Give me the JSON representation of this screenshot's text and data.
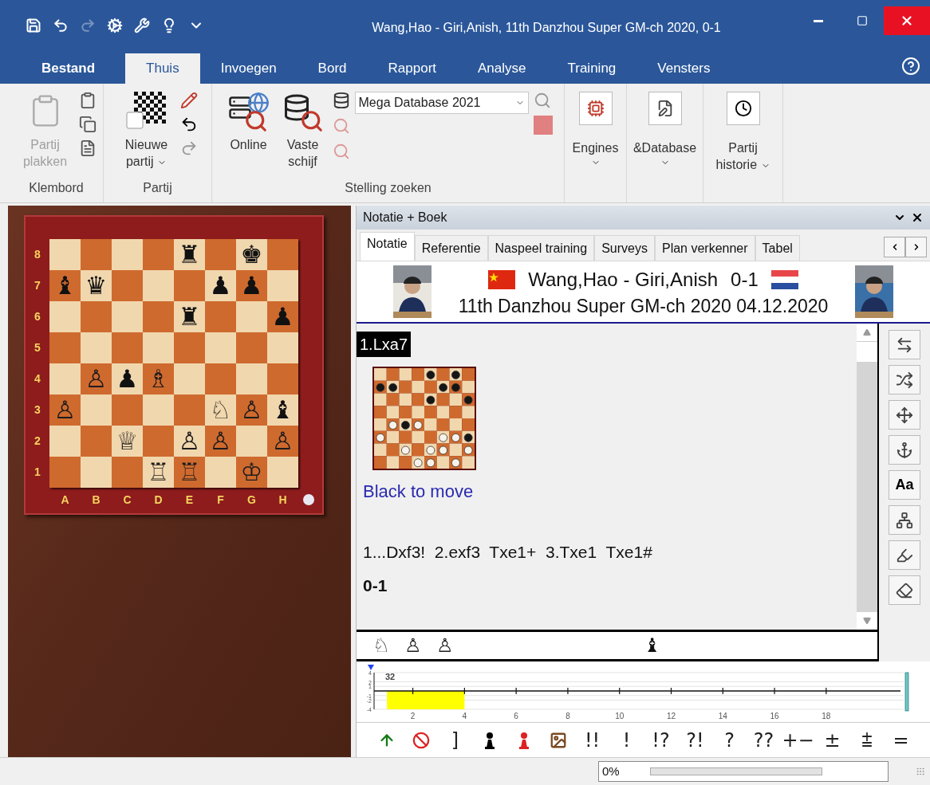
{
  "window": {
    "title": "Wang,Hao - Giri,Anish, 11th Danzhou Super GM-ch 2020, 0-1"
  },
  "quick_access": [
    {
      "kind": "save",
      "disabled": false
    },
    {
      "kind": "undo",
      "disabled": false
    },
    {
      "kind": "redo",
      "disabled": true
    },
    {
      "kind": "engine",
      "disabled": false
    },
    {
      "kind": "wrench",
      "disabled": false
    },
    {
      "kind": "bulb",
      "disabled": false
    },
    {
      "kind": "customize",
      "disabled": false
    }
  ],
  "ribbon_tabs": [
    {
      "label": "Bestand",
      "kind": "file",
      "selected": false
    },
    {
      "label": "Thuis",
      "kind": "tab",
      "selected": true
    },
    {
      "label": "Invoegen",
      "kind": "tab",
      "selected": false
    },
    {
      "label": "Bord",
      "kind": "tab",
      "selected": false
    },
    {
      "label": "Rapport",
      "kind": "tab",
      "selected": false
    },
    {
      "label": "Analyse",
      "kind": "tab",
      "selected": false
    },
    {
      "label": "Training",
      "kind": "tab",
      "selected": false
    },
    {
      "label": "Vensters",
      "kind": "tab",
      "selected": false
    }
  ],
  "clipboard_group": {
    "label": "Klembord",
    "paste": {
      "label": "Partij plakken",
      "disabled": true
    }
  },
  "game_group": {
    "label": "Partij",
    "new_game": {
      "label": "Nieuwe partij"
    }
  },
  "search_group": {
    "label": "Stelling zoeken",
    "online": {
      "label": "Online"
    },
    "hard_disk": {
      "label": "Vaste schijf"
    },
    "database_select": {
      "value": "Mega Database 2021"
    }
  },
  "tools_group": [
    {
      "label": "Engines",
      "kind": "engines"
    },
    {
      "label": "&Database",
      "kind": "database"
    },
    {
      "label": "Partij historie",
      "kind": "history"
    }
  ],
  "board": {
    "rows": [
      {
        "rank": "8",
        "squares": [
          {
            "kind": "empty"
          },
          {
            "kind": "empty"
          },
          {
            "kind": "empty"
          },
          {
            "kind": "empty"
          },
          {
            "kind": "black",
            "glyph": "♜"
          },
          {
            "kind": "empty"
          },
          {
            "kind": "black",
            "glyph": "♚"
          },
          {
            "kind": "empty"
          }
        ]
      },
      {
        "rank": "7",
        "squares": [
          {
            "kind": "black",
            "glyph": "♝"
          },
          {
            "kind": "black",
            "glyph": "♛"
          },
          {
            "kind": "empty"
          },
          {
            "kind": "empty"
          },
          {
            "kind": "empty"
          },
          {
            "kind": "black",
            "glyph": "♟"
          },
          {
            "kind": "black",
            "glyph": "♟"
          },
          {
            "kind": "empty"
          }
        ]
      },
      {
        "rank": "6",
        "squares": [
          {
            "kind": "empty"
          },
          {
            "kind": "empty"
          },
          {
            "kind": "empty"
          },
          {
            "kind": "empty"
          },
          {
            "kind": "black",
            "glyph": "♜"
          },
          {
            "kind": "empty"
          },
          {
            "kind": "empty"
          },
          {
            "kind": "black",
            "glyph": "♟"
          }
        ]
      },
      {
        "rank": "5",
        "squares": [
          {
            "kind": "empty"
          },
          {
            "kind": "empty"
          },
          {
            "kind": "empty"
          },
          {
            "kind": "empty"
          },
          {
            "kind": "empty"
          },
          {
            "kind": "empty"
          },
          {
            "kind": "empty"
          },
          {
            "kind": "empty"
          }
        ]
      },
      {
        "rank": "4",
        "squares": [
          {
            "kind": "empty"
          },
          {
            "kind": "white",
            "glyph": "♙"
          },
          {
            "kind": "black",
            "glyph": "♟"
          },
          {
            "kind": "white",
            "glyph": "♗"
          },
          {
            "kind": "empty"
          },
          {
            "kind": "empty"
          },
          {
            "kind": "empty"
          },
          {
            "kind": "empty"
          }
        ]
      },
      {
        "rank": "3",
        "squares": [
          {
            "kind": "white",
            "glyph": "♙"
          },
          {
            "kind": "empty"
          },
          {
            "kind": "empty"
          },
          {
            "kind": "empty"
          },
          {
            "kind": "empty"
          },
          {
            "kind": "white",
            "glyph": "♘"
          },
          {
            "kind": "white",
            "glyph": "♙"
          },
          {
            "kind": "black",
            "glyph": "♝"
          }
        ]
      },
      {
        "rank": "2",
        "squares": [
          {
            "kind": "empty"
          },
          {
            "kind": "empty"
          },
          {
            "kind": "white",
            "glyph": "♕"
          },
          {
            "kind": "empty"
          },
          {
            "kind": "white",
            "glyph": "♙"
          },
          {
            "kind": "white",
            "glyph": "♙"
          },
          {
            "kind": "empty"
          },
          {
            "kind": "white",
            "glyph": "♙"
          }
        ]
      },
      {
        "rank": "1",
        "squares": [
          {
            "kind": "empty"
          },
          {
            "kind": "empty"
          },
          {
            "kind": "empty"
          },
          {
            "kind": "white",
            "glyph": "♖"
          },
          {
            "kind": "white",
            "glyph": "♖"
          },
          {
            "kind": "empty"
          },
          {
            "kind": "white",
            "glyph": "♔"
          },
          {
            "kind": "empty"
          }
        ]
      }
    ],
    "files": [
      "A",
      "B",
      "C",
      "D",
      "E",
      "F",
      "G",
      "H"
    ]
  },
  "panel": {
    "title": "Notatie + Boek",
    "tabs": [
      {
        "label": "Notatie",
        "selected": true
      },
      {
        "label": "Referentie",
        "selected": false
      },
      {
        "label": "Naspeel training",
        "selected": false
      },
      {
        "label": "Surveys",
        "selected": false
      },
      {
        "label": "Plan verkenner",
        "selected": false
      },
      {
        "label": "Tabel",
        "selected": false
      }
    ]
  },
  "game_header": {
    "players": "Wang,Hao - Giri,Anish",
    "result": "0-1",
    "event": "11th Danzhou Super GM-ch 2020 04.12.2020"
  },
  "notation": {
    "current_move": {
      "text": "1.Lxa7",
      "selected": true
    },
    "caption": "Black to move",
    "moves": "1...Dxf3!  2.exf3  Txe1+  3.Txe1  Txe1#",
    "result": "0-1"
  },
  "side_tools": [
    {
      "kind": "icon"
    },
    {
      "kind": "icon"
    },
    {
      "kind": "icon"
    },
    {
      "kind": "icon"
    },
    {
      "kind": "text",
      "label": "Aa"
    },
    {
      "kind": "icon"
    },
    {
      "kind": "icon"
    },
    {
      "kind": "icon"
    }
  ],
  "material": [
    {
      "kind": "white",
      "glyph": "♘"
    },
    {
      "kind": "white",
      "glyph": "♙"
    },
    {
      "kind": "white",
      "glyph": "♙"
    },
    {
      "kind": "black",
      "glyph": "♝"
    }
  ],
  "eval_chart": {
    "chart_data": {
      "type": "area",
      "x": [
        1,
        4
      ],
      "series": [
        {
          "color": "#ffff00",
          "values": [
            -4,
            -4
          ]
        }
      ],
      "xlim": [
        0.5,
        21
      ],
      "ylim": [
        -4,
        4
      ],
      "grid": true,
      "xticks": [
        {
          "value": 2,
          "label": "2"
        },
        {
          "value": 4,
          "label": "4"
        },
        {
          "value": 6,
          "label": "6"
        },
        {
          "value": 8,
          "label": "8"
        },
        {
          "value": 10,
          "label": "10"
        },
        {
          "value": 12,
          "label": "12"
        },
        {
          "value": 14,
          "label": "14"
        },
        {
          "value": 16,
          "label": "16"
        },
        {
          "value": 18,
          "label": "18"
        }
      ],
      "yticks": [
        {
          "value": 4,
          "label": "4"
        },
        {
          "value": 2,
          "label": "2"
        },
        {
          "value": 1,
          "label": "1"
        },
        {
          "value": -1,
          "label": "-1"
        },
        {
          "value": -2,
          "label": "-2"
        },
        {
          "value": -4,
          "label": "-4"
        }
      ],
      "annotations": [
        "32"
      ]
    }
  },
  "annotation_tools": [
    {
      "kind": "icon"
    },
    {
      "kind": "icon"
    },
    {
      "kind": "text",
      "label": "]"
    },
    {
      "kind": "icon"
    },
    {
      "kind": "icon"
    },
    {
      "kind": "icon"
    },
    {
      "kind": "text",
      "label": "!!"
    },
    {
      "kind": "text",
      "label": "!"
    },
    {
      "kind": "text",
      "label": "!?"
    },
    {
      "kind": "text",
      "label": "?!"
    },
    {
      "kind": "text",
      "label": "?"
    },
    {
      "kind": "text",
      "label": "??"
    },
    {
      "kind": "text",
      "label": "+−"
    },
    {
      "kind": "text",
      "label": "±"
    },
    {
      "kind": "text",
      "label": "⩲"
    },
    {
      "kind": "text",
      "label": "="
    }
  ],
  "status": {
    "progress": {
      "reading": "0%",
      "level": 0
    }
  }
}
